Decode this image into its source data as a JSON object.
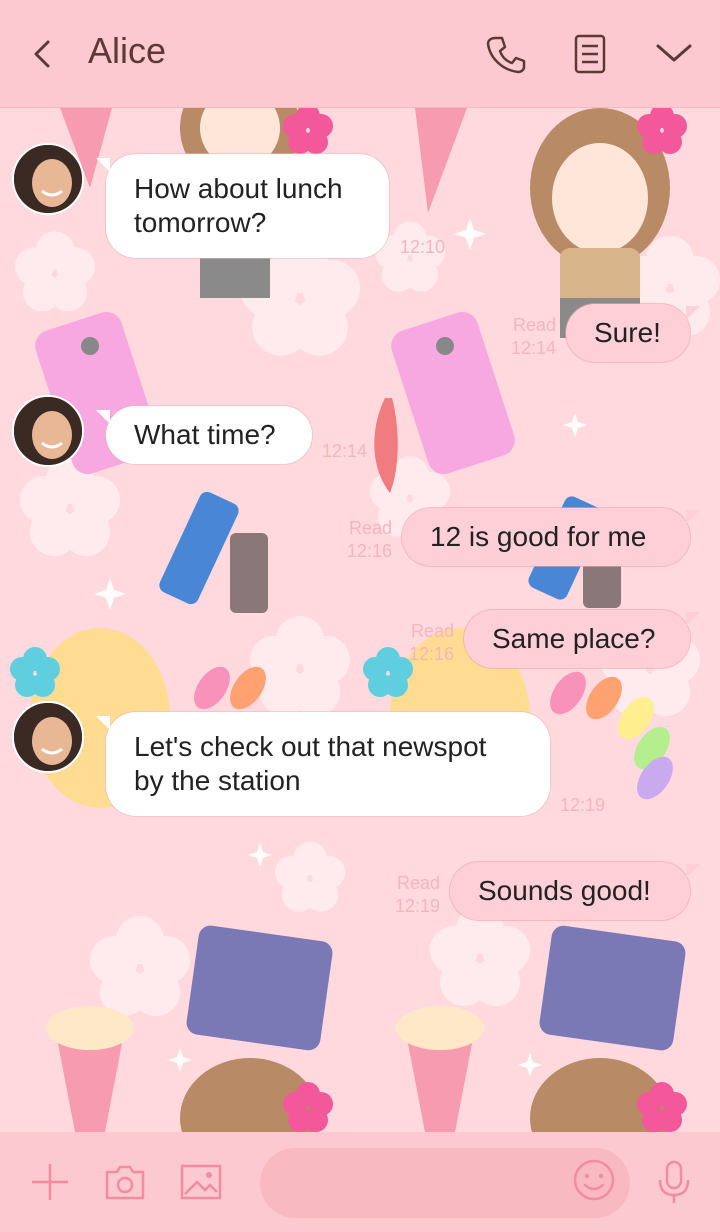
{
  "header": {
    "title": "Alice",
    "icons": [
      "back-chevron-icon",
      "phone-icon",
      "notes-icon",
      "chevron-down-icon"
    ]
  },
  "messages": [
    {
      "side": "in",
      "lines": [
        "How about lunch",
        "tomorrow?"
      ],
      "time": "12:10"
    },
    {
      "side": "out",
      "text": "Sure!",
      "read": "Read",
      "time": "12:14"
    },
    {
      "side": "in",
      "lines": [
        "What time?"
      ],
      "time": "12:14"
    },
    {
      "side": "out",
      "text": "12 is good for me",
      "read": "Read",
      "time": "12:16"
    },
    {
      "side": "out",
      "text": "Same place?",
      "read": "Read",
      "time": "12:16"
    },
    {
      "side": "in",
      "lines": [
        "Let's check out that newspot",
        "by the station"
      ],
      "time": "12:19"
    },
    {
      "side": "out",
      "text": "Sounds good!",
      "read": "Read",
      "time": "12:19"
    }
  ],
  "footer": {
    "input_placeholder": "",
    "icons": [
      "plus-icon",
      "camera-icon",
      "image-icon",
      "emoji-icon",
      "microphone-icon"
    ]
  },
  "colors": {
    "header_bg": "#fdc9d0",
    "background": "#ffd9de",
    "outgoing_bubble": "#fecfd6",
    "incoming_bubble": "#ffffff",
    "accent_pink": "#f48ba0",
    "timestamp": "#f5b5bd"
  }
}
